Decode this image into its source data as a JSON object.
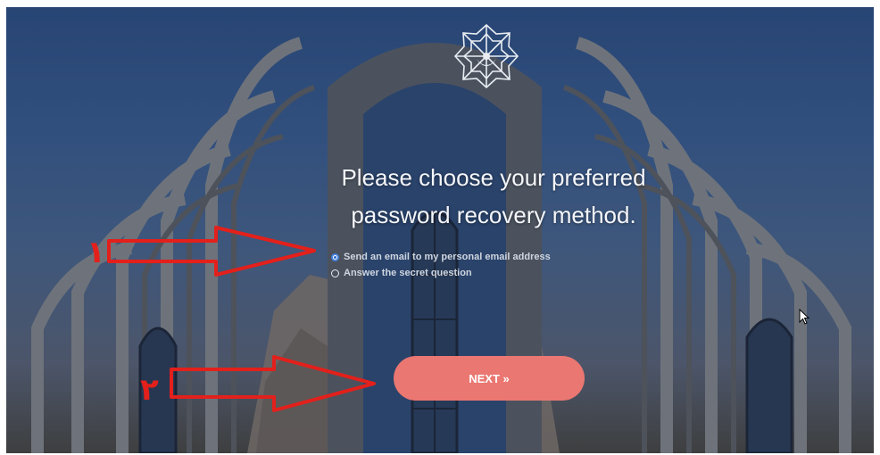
{
  "page": {
    "title_line1": "Please choose your preferred",
    "title_line2": "password recovery method."
  },
  "recovery_options": [
    {
      "label": "Send an email to my personal email address",
      "selected": true
    },
    {
      "label": "Answer the secret question",
      "selected": false
    }
  ],
  "next_button": {
    "label": "NEXT »"
  },
  "annotations": {
    "arrow_1_label": "١",
    "arrow_2_label": "٢"
  },
  "colors": {
    "sky": "#2c4f86",
    "arch": "#7d7f82",
    "button": "#ea7772",
    "annotation_red": "#e3201b",
    "radio_selected": "#3d7bd8"
  },
  "icons": {
    "logo": "university-emblem-logo",
    "cursor": "mouse-pointer-icon"
  }
}
